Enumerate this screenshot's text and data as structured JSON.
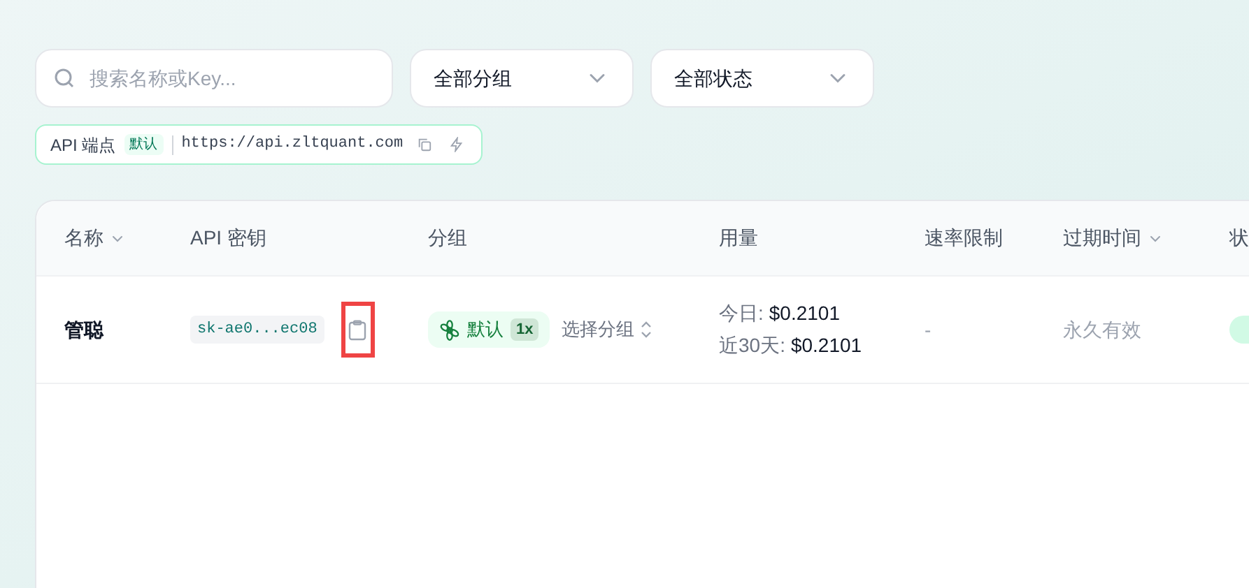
{
  "search": {
    "placeholder": "搜索名称或Key..."
  },
  "filters": [
    {
      "label": "全部分组"
    },
    {
      "label": "全部状态"
    }
  ],
  "endpoint": {
    "label": "API 端点",
    "badge": "默认",
    "url": "https://api.zltquant.com"
  },
  "table": {
    "columns": [
      {
        "label": "名称",
        "sortable": true
      },
      {
        "label": "API 密钥",
        "sortable": false
      },
      {
        "label": "分组",
        "sortable": false
      },
      {
        "label": "用量",
        "sortable": false
      },
      {
        "label": "速率限制",
        "sortable": false
      },
      {
        "label": "过期时间",
        "sortable": true
      },
      {
        "label": "状"
      }
    ],
    "rows": [
      {
        "name": "管聪",
        "key": "sk-ae0...ec08",
        "copy_highlighted": true,
        "group": "默认",
        "ratio": "1x",
        "group_select": "选择分组",
        "usage": [
          {
            "label": "今日:",
            "value": "$0.2101"
          },
          {
            "label": "近30天:",
            "value": "$0.2101"
          }
        ],
        "rate_limit": "-",
        "expiry": "永久有效"
      }
    ]
  }
}
